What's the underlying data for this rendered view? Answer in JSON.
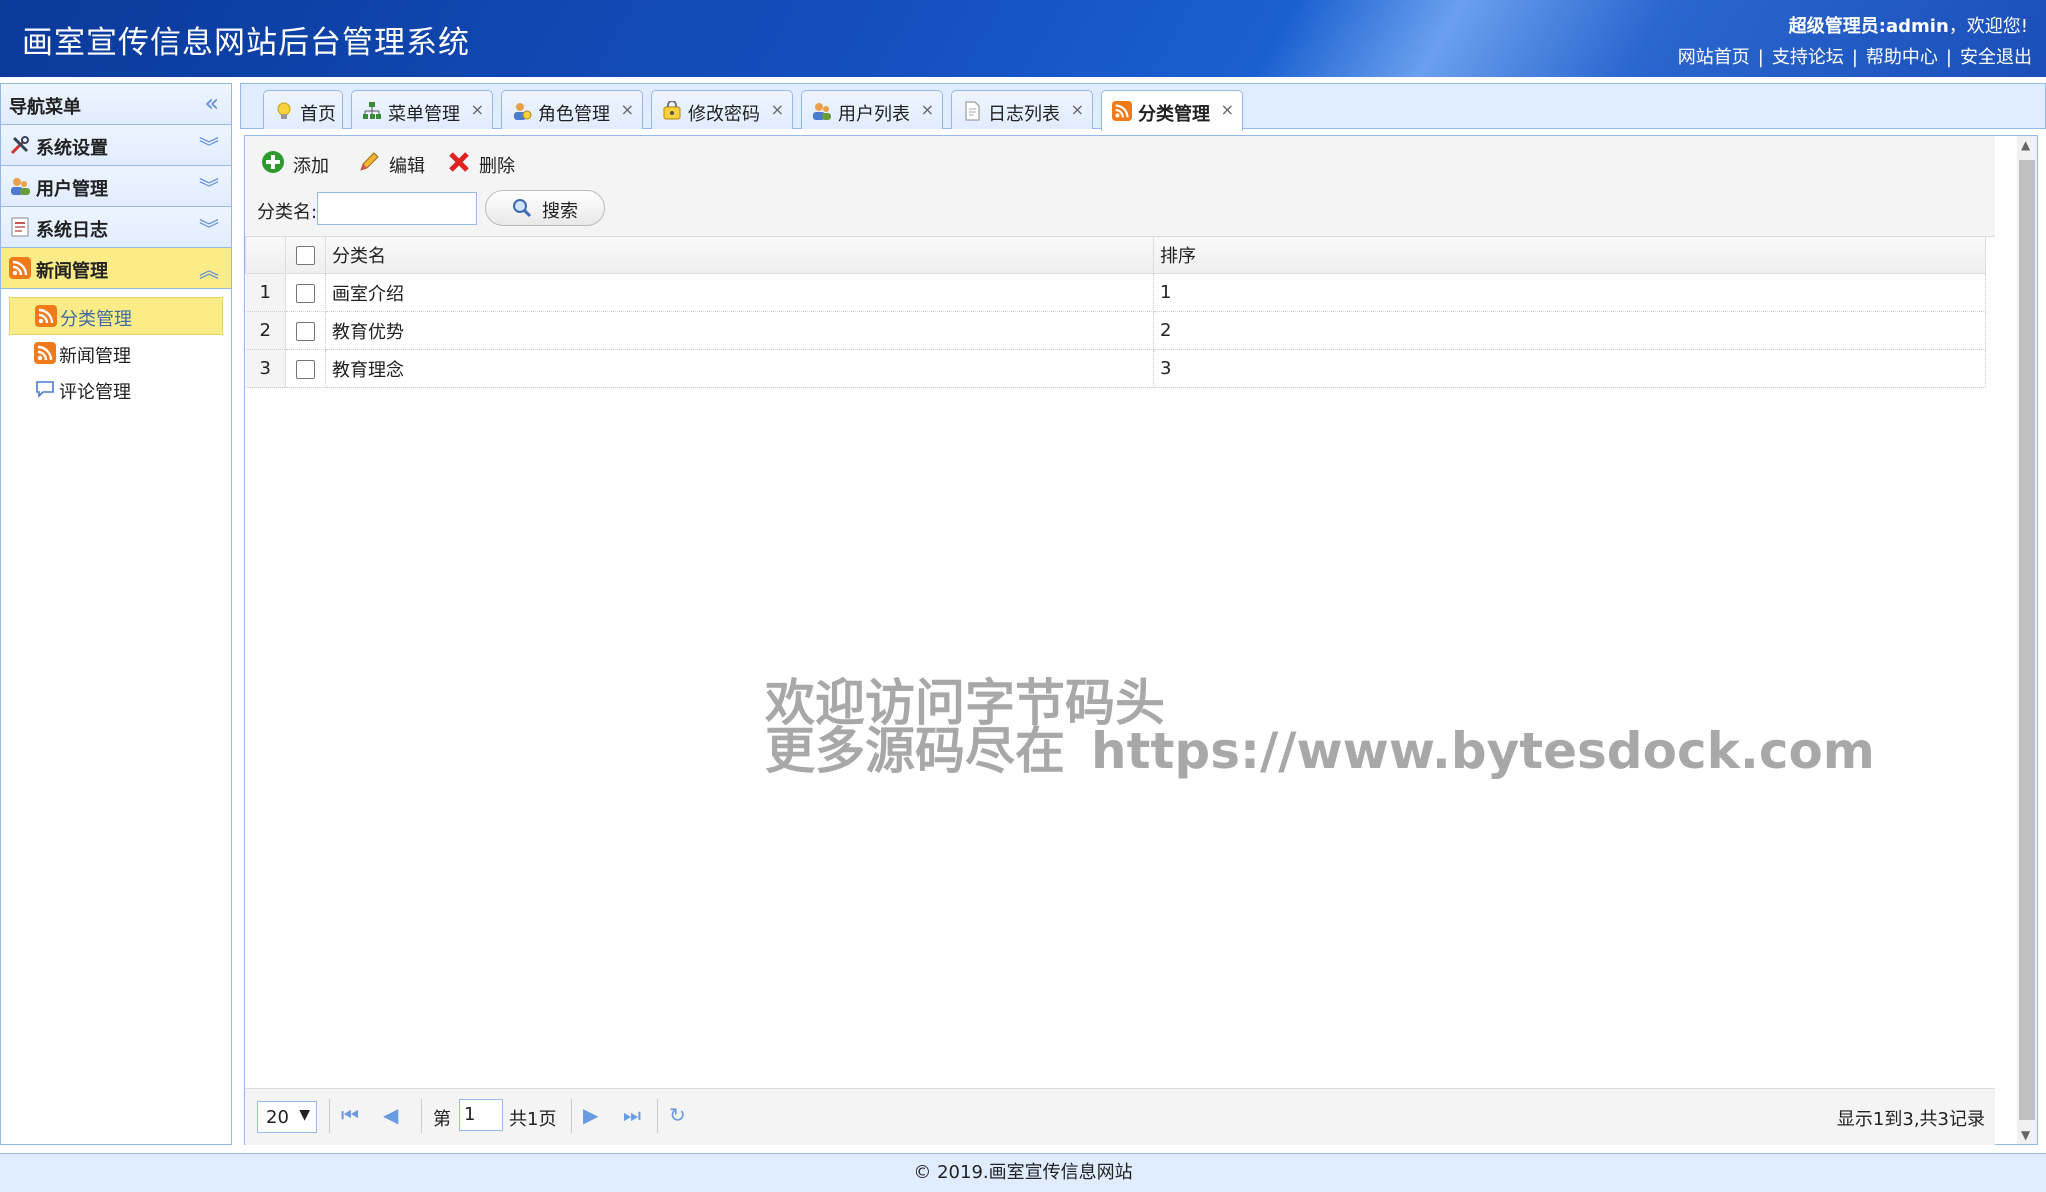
{
  "header": {
    "title": "画室宣传信息网站后台管理系统",
    "user_role": "超级管理员:admin",
    "welcome_suffix": "，欢迎您!",
    "links": [
      "网站首页",
      "支持论坛",
      "帮助中心",
      "安全退出"
    ],
    "sep": "|"
  },
  "sidebar": {
    "title": "导航菜单",
    "collapse_glyph": "«",
    "panels": [
      {
        "label": "系统设置",
        "icon": "tools-icon",
        "state": "collapsed"
      },
      {
        "label": "用户管理",
        "icon": "users-icon",
        "state": "collapsed"
      },
      {
        "label": "系统日志",
        "icon": "log-icon",
        "state": "collapsed"
      },
      {
        "label": "新闻管理",
        "icon": "rss-icon",
        "state": "expanded"
      }
    ],
    "items": [
      {
        "label": "分类管理",
        "icon": "rss-icon",
        "selected": true
      },
      {
        "label": "新闻管理",
        "icon": "rss-icon",
        "selected": false
      },
      {
        "label": "评论管理",
        "icon": "comment-icon",
        "selected": false
      }
    ]
  },
  "tabs": [
    {
      "label": "首页",
      "icon": "bulb-icon",
      "closable": false
    },
    {
      "label": "菜单管理",
      "icon": "sitemap-icon",
      "closable": true
    },
    {
      "label": "角色管理",
      "icon": "role-icon",
      "closable": true
    },
    {
      "label": "修改密码",
      "icon": "password-icon",
      "closable": true
    },
    {
      "label": "用户列表",
      "icon": "users-icon",
      "closable": true
    },
    {
      "label": "日志列表",
      "icon": "document-icon",
      "closable": true
    },
    {
      "label": "分类管理",
      "icon": "rss-icon",
      "closable": true,
      "active": true
    }
  ],
  "close_glyph": "×",
  "toolbar": {
    "add": "添加",
    "edit": "编辑",
    "delete": "删除"
  },
  "search": {
    "label": "分类名:",
    "placeholder": "",
    "value": "",
    "button": "搜索"
  },
  "grid": {
    "columns": [
      "分类名",
      "排序"
    ],
    "rows": [
      {
        "num": "1",
        "name": "画室介绍",
        "order": "1"
      },
      {
        "num": "2",
        "name": "教育优势",
        "order": "2"
      },
      {
        "num": "3",
        "name": "教育理念",
        "order": "3"
      }
    ]
  },
  "watermark": {
    "line1": "欢迎访问字节码头",
    "line2a": "更多源码尽在",
    "line2b": "https://www.bytesdock.com"
  },
  "pager": {
    "page_size": "20",
    "page_prefix": "第",
    "page_value": "1",
    "page_suffix": "共1页",
    "info": "显示1到3,共3记录"
  },
  "footer": {
    "text": "© 2019.画室宣传信息网站"
  },
  "colors": {
    "header_blue": "#1550c0",
    "panel_border": "#95b8e7",
    "selected_yellow": "#fbec88"
  }
}
